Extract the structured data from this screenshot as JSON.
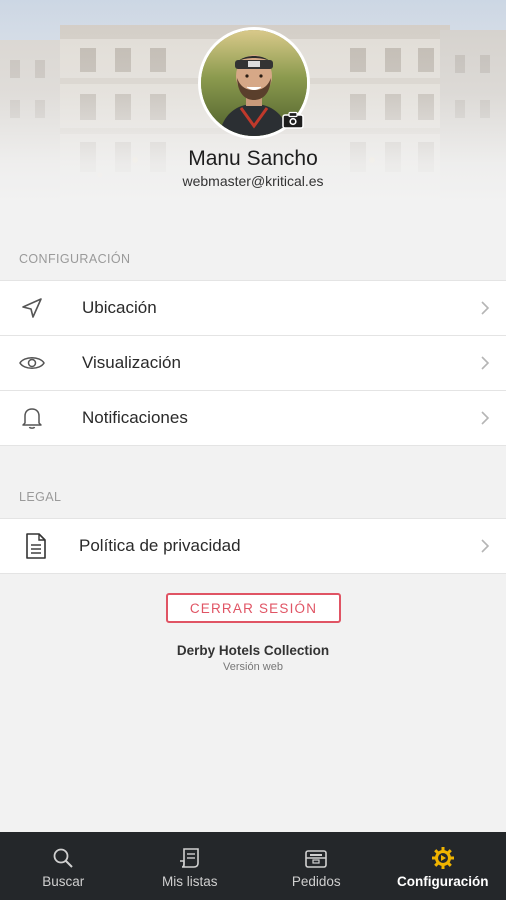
{
  "profile": {
    "name": "Manu Sancho",
    "email": "webmaster@kritical.es"
  },
  "sections": {
    "configuracion": {
      "title": "CONFIGURACIÓN",
      "items": [
        {
          "label": "Ubicación",
          "icon": "location-arrow-icon"
        },
        {
          "label": "Visualización",
          "icon": "eye-icon"
        },
        {
          "label": "Notificaciones",
          "icon": "bell-icon"
        }
      ]
    },
    "legal": {
      "title": "LEGAL",
      "items": [
        {
          "label": "Política de privacidad",
          "icon": "document-icon"
        }
      ]
    }
  },
  "logout_label": "CERRAR SESIÓN",
  "footer": {
    "brand": "Derby Hotels Collection",
    "version": "Versión web"
  },
  "nav": {
    "items": [
      {
        "label": "Buscar",
        "icon": "search-icon",
        "active": false
      },
      {
        "label": "Mis listas",
        "icon": "list-icon",
        "active": false
      },
      {
        "label": "Pedidos",
        "icon": "inbox-icon",
        "active": false
      },
      {
        "label": "Configuración",
        "icon": "gear-icon",
        "active": true
      }
    ]
  },
  "colors": {
    "accent": "#e05464",
    "active_icon": "#f0b400",
    "nav_background": "#24272a",
    "page_background": "#f2f2f2"
  }
}
